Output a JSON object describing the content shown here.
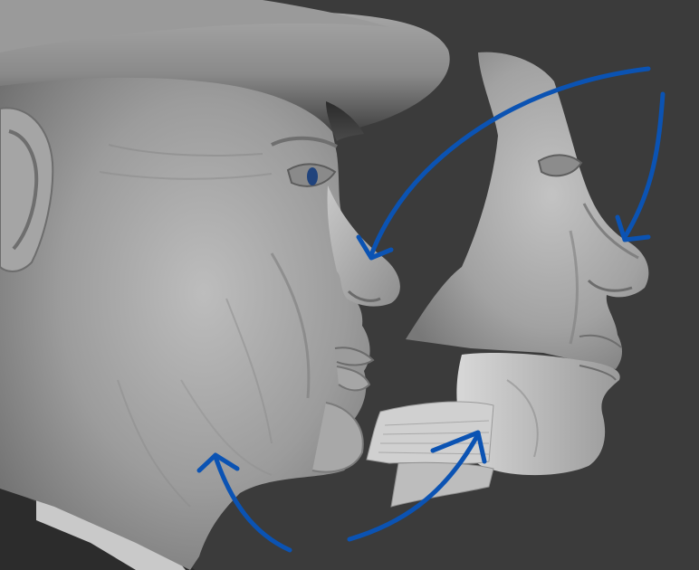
{
  "scene": {
    "background_color": "#3b3b3b",
    "mesh_color": "#a9a9a9",
    "annotation_color": "#0b53b3",
    "objects": [
      {
        "name": "full-head-model",
        "type": "sculpted-head-with-hat"
      },
      {
        "name": "upper-face-fragment",
        "type": "face-mesh-piece"
      },
      {
        "name": "lower-jaw-fragment",
        "type": "jaw-mesh-piece"
      },
      {
        "name": "neck-fragment",
        "type": "neck-mesh-piece"
      }
    ],
    "annotations": [
      {
        "name": "arrow-to-nose-main",
        "type": "curved-arrow"
      },
      {
        "name": "arrow-to-nose-fragment",
        "type": "curved-arrow"
      },
      {
        "name": "arrow-to-jaw-main",
        "type": "curved-arrow"
      },
      {
        "name": "arrow-to-jaw-fragment",
        "type": "curved-arrow"
      }
    ]
  }
}
